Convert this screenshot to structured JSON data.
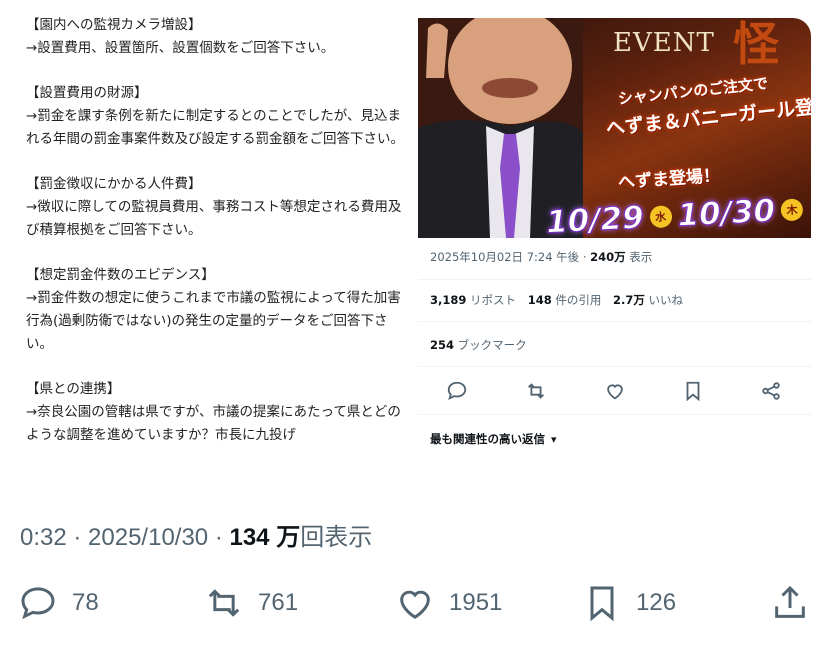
{
  "document": {
    "sections": [
      {
        "heading": "【園内への監視カメラ増設】",
        "body": "→設置費用、設置箇所、設置個数をご回答下さい。"
      },
      {
        "heading": "【設置費用の財源】",
        "body": "→罰金を課す条例を新たに制定するとのことでしたが、見込まれる年間の罰金事案件数及び設定する罰金額をご回答下さい。"
      },
      {
        "heading": "【罰金徴収にかかる人件費】",
        "body": "→徴収に際しての監視員費用、事務コスト等想定される費用及び積算根拠をご回答下さい。"
      },
      {
        "heading": "【想定罰金件数のエビデンス】",
        "body": "→罰金件数の想定に使うこれまで市議の監視によって得た加害行為(過剰防衛ではない)の発生の定量的データをご回答下さい。"
      },
      {
        "heading": "【県との連携】",
        "body": "→奈良公園の管轄は県ですが、市議の提案にあたって県とどのような調整を進めていますか？市長に九投げ"
      }
    ]
  },
  "embedded_post": {
    "image": {
      "event_label": "EVENT",
      "promo_line1": "シャンパンのご注文で",
      "promo_line2": "へずま＆バニーガール登場！",
      "promo_line3": "へずま登場！",
      "date1": "10/29",
      "dow1": "水",
      "date2": "10/30",
      "dow2": "木"
    },
    "timestamp": "2025年10月02日 7:24 午後 · ",
    "views_count": "240万",
    "views_label": " 表示",
    "reposts_count": "3,189",
    "reposts_label": " リポスト",
    "quotes_count": "148",
    "quotes_label": " 件の引用",
    "likes_count": "2.7万",
    "likes_label": " いいね",
    "bookmarks_count": "254",
    "bookmarks_label": " ブックマーク",
    "sort_label": "最も関連性の高い返信"
  },
  "tweet": {
    "time_prefix": "0:32 · 2025/10/30 · ",
    "views_count": "134 万",
    "views_label": "回表示",
    "replies": "78",
    "reposts": "761",
    "likes": "1951",
    "bookmarks": "126"
  },
  "colors": {
    "text": "#0f1419",
    "secondary": "#536471",
    "divider": "#eff3f4"
  },
  "icons": [
    "reply-icon",
    "repost-icon",
    "like-icon",
    "bookmark-icon",
    "share-icon"
  ]
}
